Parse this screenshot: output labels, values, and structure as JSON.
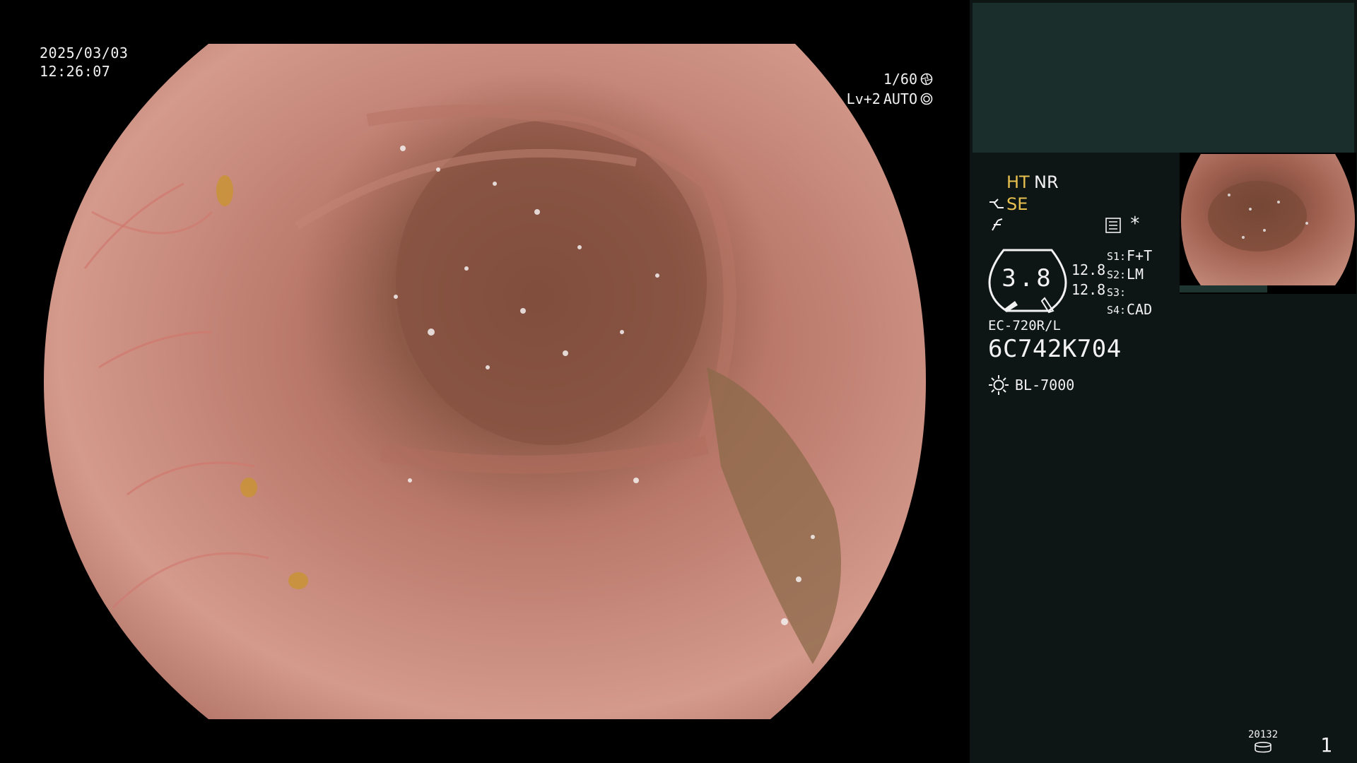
{
  "overlay": {
    "date": "2025/03/03",
    "time": "12:26:07",
    "shutter": "1/60",
    "level": "Lv+2",
    "mode": "AUTO",
    "shutter_icon": "aperture-icon",
    "mode_icon": "auto-iris-icon"
  },
  "panel": {
    "enhancement": {
      "ht": "HT",
      "nr": "NR",
      "se": "SE"
    },
    "gauge_value": "3.8",
    "gauge_read_1": "12.8",
    "gauge_read_2": "12.8",
    "switches": [
      {
        "label": "S1:",
        "value": "F+T"
      },
      {
        "label": "S2:",
        "value": "LM"
      },
      {
        "label": "S3:",
        "value": ""
      },
      {
        "label": "S4:",
        "value": "CAD"
      }
    ],
    "scope_model": "EC-720R/L",
    "serial": "6C742K704",
    "light_source": "BL-7000",
    "asterisk": "*"
  },
  "footer": {
    "disk_count": "20132",
    "page": "1"
  },
  "colors": {
    "accent_yellow": "#e8c050",
    "panel_bg": "#0d1614",
    "panel_top": "#1a2e2b"
  }
}
